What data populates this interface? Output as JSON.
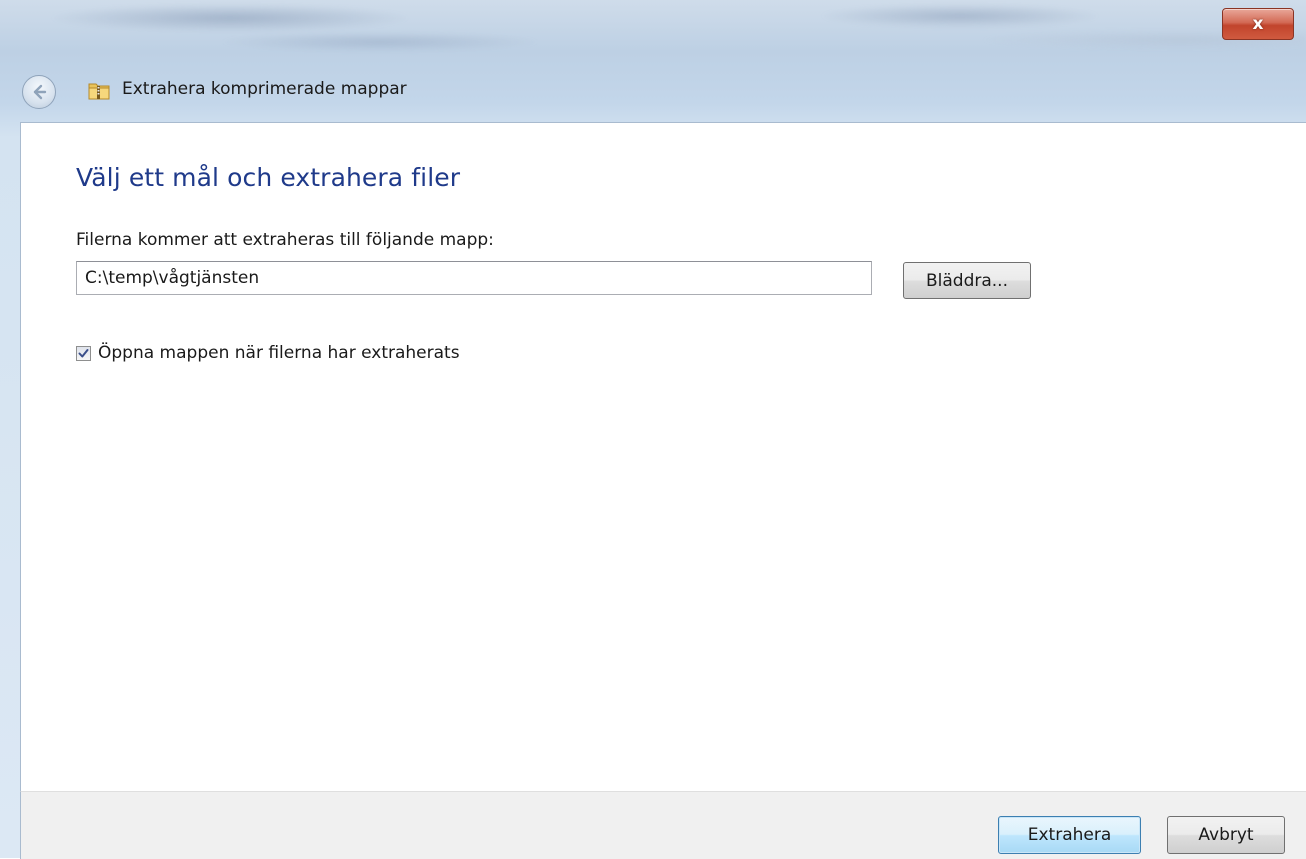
{
  "window": {
    "title": "Extrahera komprimerade mappar",
    "close_glyph": "x"
  },
  "wizard": {
    "heading": "Välj ett mål och extrahera filer",
    "destination_label": "Filerna kommer att extraheras till följande mapp:",
    "destination_value": "C:\\temp\\vågtjänsten",
    "browse_label": "Bläddra...",
    "open_folder_label": "Öppna mappen när filerna har extraherats",
    "open_folder_checked": true
  },
  "footer": {
    "extract_label": "Extrahera",
    "cancel_label": "Avbryt"
  },
  "icons": {
    "back": "back-arrow-icon",
    "folder": "zip-folder-icon",
    "close": "close-icon",
    "check": "checkmark-icon"
  },
  "colors": {
    "heading": "#1f3a8a",
    "close_button": "#c1442c",
    "default_button_border": "#3c7fb1",
    "footer_bg": "#f0f0f0"
  }
}
